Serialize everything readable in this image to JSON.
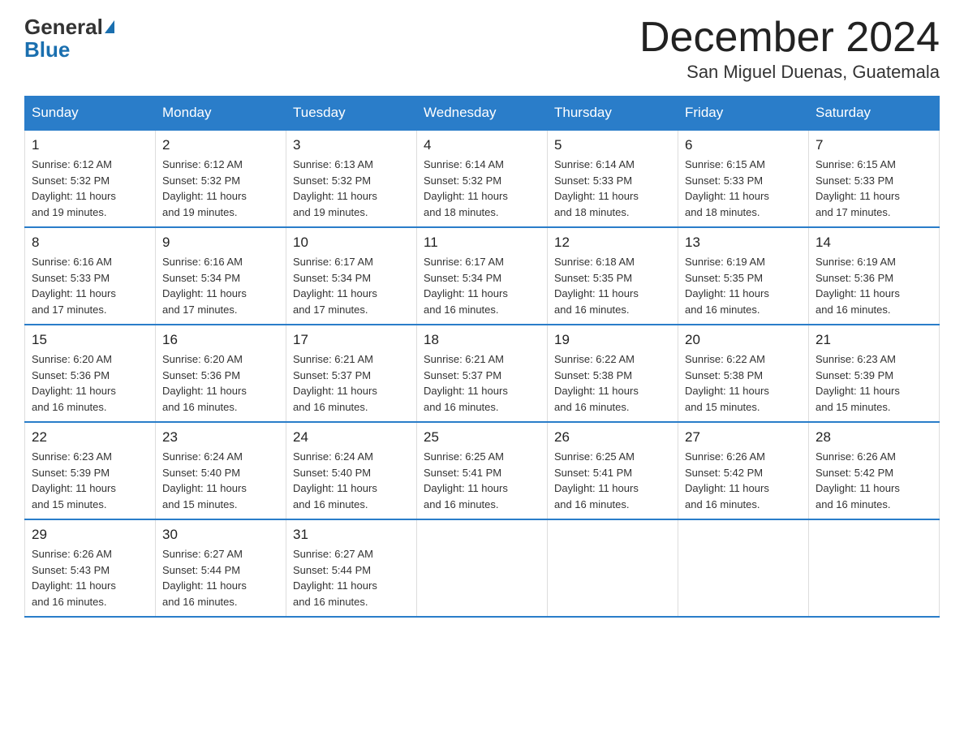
{
  "header": {
    "logo_general": "General",
    "logo_blue": "Blue",
    "month_title": "December 2024",
    "location": "San Miguel Duenas, Guatemala"
  },
  "columns": [
    "Sunday",
    "Monday",
    "Tuesday",
    "Wednesday",
    "Thursday",
    "Friday",
    "Saturday"
  ],
  "weeks": [
    [
      {
        "day": "1",
        "sunrise": "6:12 AM",
        "sunset": "5:32 PM",
        "daylight": "11 hours and 19 minutes."
      },
      {
        "day": "2",
        "sunrise": "6:12 AM",
        "sunset": "5:32 PM",
        "daylight": "11 hours and 19 minutes."
      },
      {
        "day": "3",
        "sunrise": "6:13 AM",
        "sunset": "5:32 PM",
        "daylight": "11 hours and 19 minutes."
      },
      {
        "day": "4",
        "sunrise": "6:14 AM",
        "sunset": "5:32 PM",
        "daylight": "11 hours and 18 minutes."
      },
      {
        "day": "5",
        "sunrise": "6:14 AM",
        "sunset": "5:33 PM",
        "daylight": "11 hours and 18 minutes."
      },
      {
        "day": "6",
        "sunrise": "6:15 AM",
        "sunset": "5:33 PM",
        "daylight": "11 hours and 18 minutes."
      },
      {
        "day": "7",
        "sunrise": "6:15 AM",
        "sunset": "5:33 PM",
        "daylight": "11 hours and 17 minutes."
      }
    ],
    [
      {
        "day": "8",
        "sunrise": "6:16 AM",
        "sunset": "5:33 PM",
        "daylight": "11 hours and 17 minutes."
      },
      {
        "day": "9",
        "sunrise": "6:16 AM",
        "sunset": "5:34 PM",
        "daylight": "11 hours and 17 minutes."
      },
      {
        "day": "10",
        "sunrise": "6:17 AM",
        "sunset": "5:34 PM",
        "daylight": "11 hours and 17 minutes."
      },
      {
        "day": "11",
        "sunrise": "6:17 AM",
        "sunset": "5:34 PM",
        "daylight": "11 hours and 16 minutes."
      },
      {
        "day": "12",
        "sunrise": "6:18 AM",
        "sunset": "5:35 PM",
        "daylight": "11 hours and 16 minutes."
      },
      {
        "day": "13",
        "sunrise": "6:19 AM",
        "sunset": "5:35 PM",
        "daylight": "11 hours and 16 minutes."
      },
      {
        "day": "14",
        "sunrise": "6:19 AM",
        "sunset": "5:36 PM",
        "daylight": "11 hours and 16 minutes."
      }
    ],
    [
      {
        "day": "15",
        "sunrise": "6:20 AM",
        "sunset": "5:36 PM",
        "daylight": "11 hours and 16 minutes."
      },
      {
        "day": "16",
        "sunrise": "6:20 AM",
        "sunset": "5:36 PM",
        "daylight": "11 hours and 16 minutes."
      },
      {
        "day": "17",
        "sunrise": "6:21 AM",
        "sunset": "5:37 PM",
        "daylight": "11 hours and 16 minutes."
      },
      {
        "day": "18",
        "sunrise": "6:21 AM",
        "sunset": "5:37 PM",
        "daylight": "11 hours and 16 minutes."
      },
      {
        "day": "19",
        "sunrise": "6:22 AM",
        "sunset": "5:38 PM",
        "daylight": "11 hours and 16 minutes."
      },
      {
        "day": "20",
        "sunrise": "6:22 AM",
        "sunset": "5:38 PM",
        "daylight": "11 hours and 15 minutes."
      },
      {
        "day": "21",
        "sunrise": "6:23 AM",
        "sunset": "5:39 PM",
        "daylight": "11 hours and 15 minutes."
      }
    ],
    [
      {
        "day": "22",
        "sunrise": "6:23 AM",
        "sunset": "5:39 PM",
        "daylight": "11 hours and 15 minutes."
      },
      {
        "day": "23",
        "sunrise": "6:24 AM",
        "sunset": "5:40 PM",
        "daylight": "11 hours and 15 minutes."
      },
      {
        "day": "24",
        "sunrise": "6:24 AM",
        "sunset": "5:40 PM",
        "daylight": "11 hours and 16 minutes."
      },
      {
        "day": "25",
        "sunrise": "6:25 AM",
        "sunset": "5:41 PM",
        "daylight": "11 hours and 16 minutes."
      },
      {
        "day": "26",
        "sunrise": "6:25 AM",
        "sunset": "5:41 PM",
        "daylight": "11 hours and 16 minutes."
      },
      {
        "day": "27",
        "sunrise": "6:26 AM",
        "sunset": "5:42 PM",
        "daylight": "11 hours and 16 minutes."
      },
      {
        "day": "28",
        "sunrise": "6:26 AM",
        "sunset": "5:42 PM",
        "daylight": "11 hours and 16 minutes."
      }
    ],
    [
      {
        "day": "29",
        "sunrise": "6:26 AM",
        "sunset": "5:43 PM",
        "daylight": "11 hours and 16 minutes."
      },
      {
        "day": "30",
        "sunrise": "6:27 AM",
        "sunset": "5:44 PM",
        "daylight": "11 hours and 16 minutes."
      },
      {
        "day": "31",
        "sunrise": "6:27 AM",
        "sunset": "5:44 PM",
        "daylight": "11 hours and 16 minutes."
      },
      {
        "day": "",
        "sunrise": "",
        "sunset": "",
        "daylight": ""
      },
      {
        "day": "",
        "sunrise": "",
        "sunset": "",
        "daylight": ""
      },
      {
        "day": "",
        "sunrise": "",
        "sunset": "",
        "daylight": ""
      },
      {
        "day": "",
        "sunrise": "",
        "sunset": "",
        "daylight": ""
      }
    ]
  ],
  "labels": {
    "sunrise": "Sunrise:",
    "sunset": "Sunset:",
    "daylight": "Daylight:"
  }
}
